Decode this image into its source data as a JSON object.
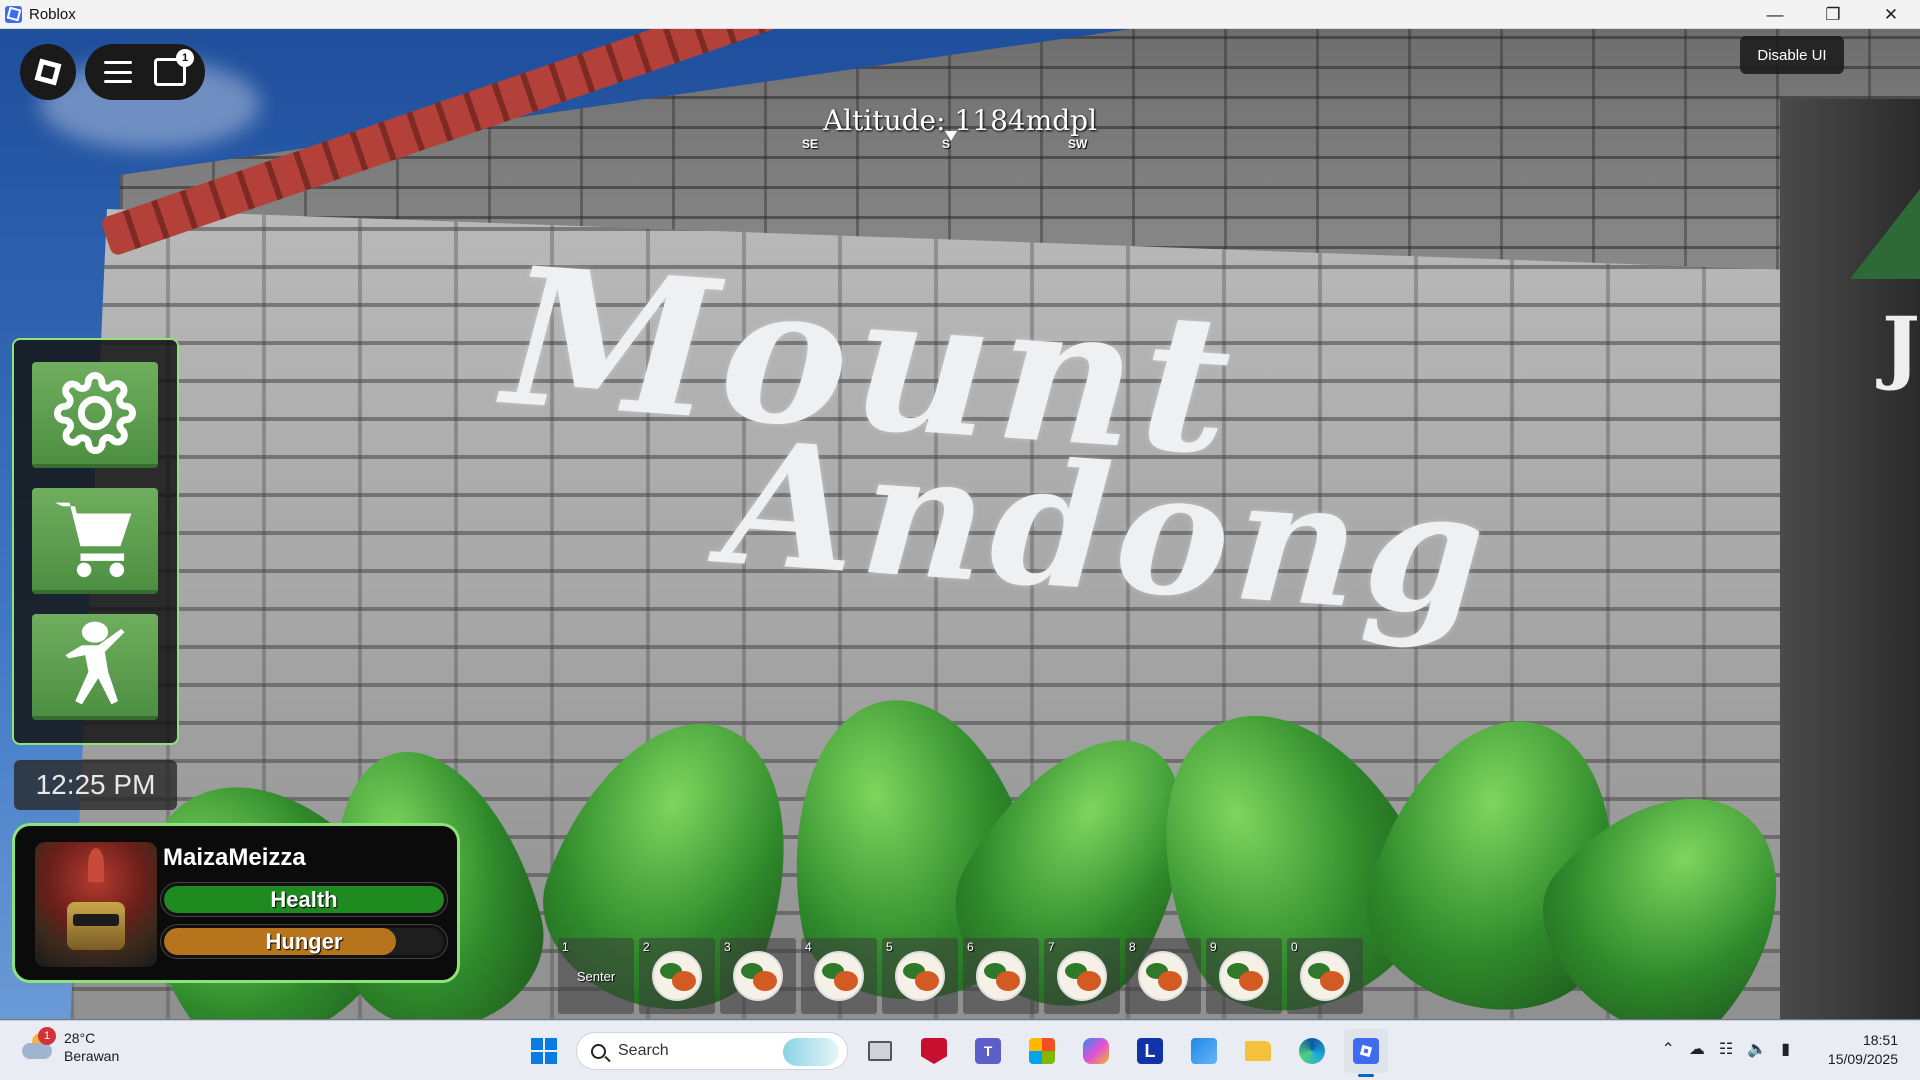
{
  "window": {
    "title": "Roblox",
    "minimize_icon": "minimize-icon",
    "restore_icon": "restore-icon",
    "close_icon": "close-icon"
  },
  "game": {
    "altitude_text": "Altitude: 1184mdpl",
    "compass": {
      "left": "SE",
      "center": "S",
      "right": "SW"
    },
    "sign": {
      "line1": "Mount",
      "line2": "Andong"
    },
    "right_edge_glyph": "J",
    "disable_ui_label": "Disable UI",
    "chat_badge_count": "1",
    "side_menu": [
      {
        "name": "settings",
        "icon": "gear-icon"
      },
      {
        "name": "shop",
        "icon": "cart-icon"
      },
      {
        "name": "emote",
        "icon": "dance-icon"
      }
    ],
    "clock": "12:25 PM",
    "player": {
      "username": "MaizaMeizza",
      "health_label": "Health",
      "health_value": 1.0,
      "hunger_label": "Hunger",
      "hunger_value": 0.83,
      "health_color": "#1f8a1f",
      "hunger_color": "#b6751c"
    },
    "hotbar": [
      {
        "key": "1",
        "label": "Senter",
        "item": ""
      },
      {
        "key": "2",
        "label": "",
        "item": "food-plate-icon"
      },
      {
        "key": "3",
        "label": "",
        "item": "food-plate-icon"
      },
      {
        "key": "4",
        "label": "",
        "item": "food-plate-icon"
      },
      {
        "key": "5",
        "label": "",
        "item": "food-plate-icon"
      },
      {
        "key": "6",
        "label": "",
        "item": "food-plate-icon"
      },
      {
        "key": "7",
        "label": "",
        "item": "food-plate-icon"
      },
      {
        "key": "8",
        "label": "",
        "item": "food-plate-icon"
      },
      {
        "key": "9",
        "label": "",
        "item": "food-plate-icon"
      },
      {
        "key": "0",
        "label": "",
        "item": "food-plate-icon"
      }
    ]
  },
  "taskbar": {
    "weather": {
      "temp": "28°C",
      "condition": "Berawan",
      "badge": "1"
    },
    "search_label": "Search",
    "apps": [
      "task-view-icon",
      "mcafee-icon",
      "teams-icon",
      "store-icon",
      "copilot-icon",
      "l-app-icon",
      "code-app-icon",
      "file-explorer-icon",
      "edge-icon",
      "roblox-icon"
    ],
    "l_app_letter": "L",
    "time": "18:51",
    "date": "15/09/2025"
  }
}
